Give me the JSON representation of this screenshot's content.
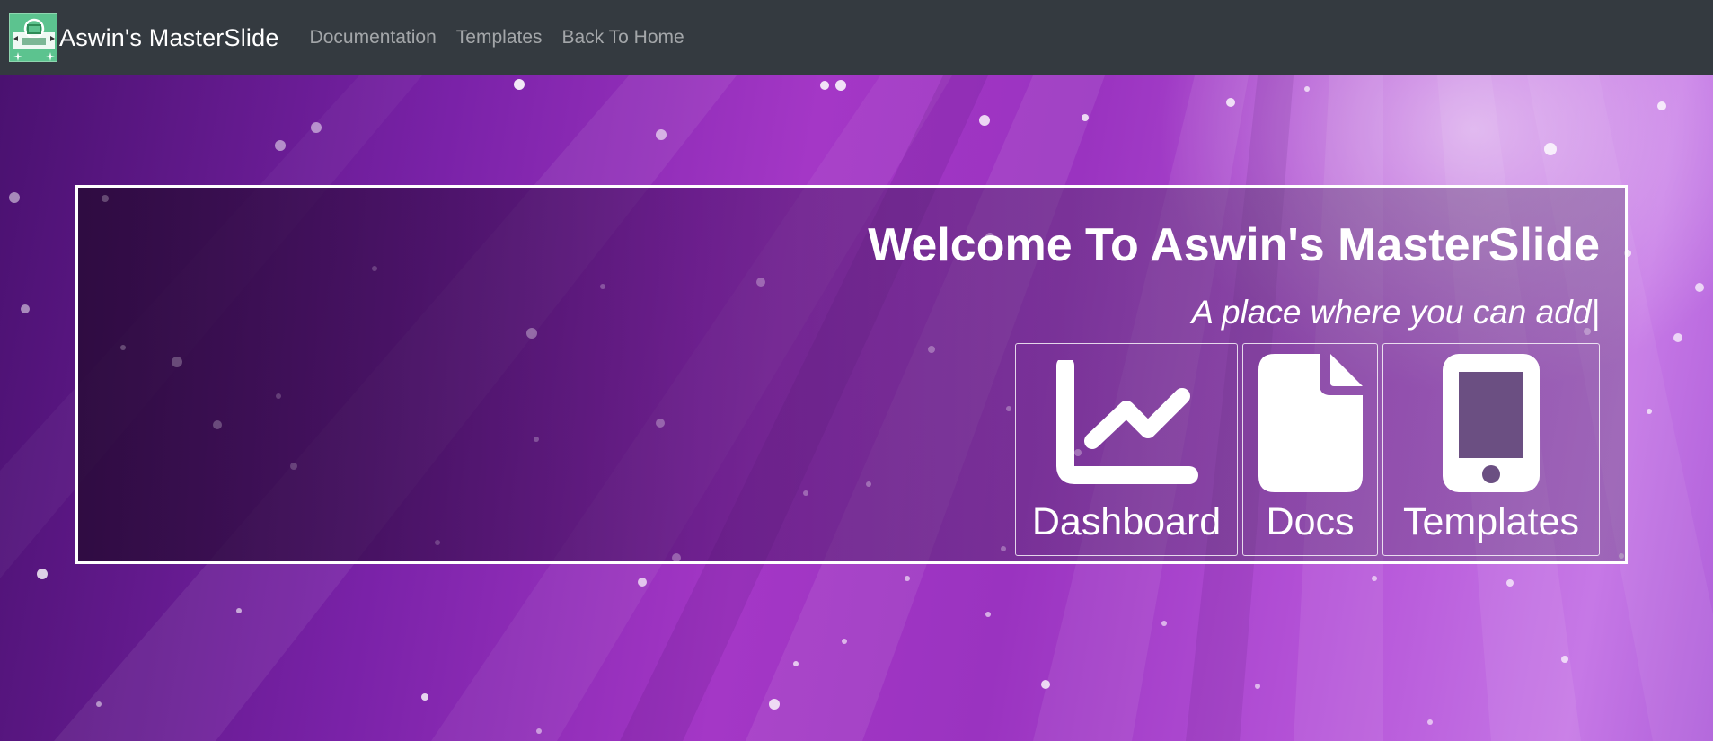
{
  "navbar": {
    "brand_title": "Aswin's MasterSlide",
    "logo_icon": "presentation-logo-icon",
    "background": "#343a40",
    "links": [
      {
        "label": "Documentation"
      },
      {
        "label": "Templates"
      },
      {
        "label": "Back To Home"
      }
    ]
  },
  "hero": {
    "title": "Welcome To Aswin's MasterSlide",
    "tagline": "A place where you can add|",
    "cards": [
      {
        "label": "Dashboard",
        "icon": "chart-line-icon"
      },
      {
        "label": "Docs",
        "icon": "document-icon"
      },
      {
        "label": "Templates",
        "icon": "mobile-phone-icon"
      }
    ]
  }
}
